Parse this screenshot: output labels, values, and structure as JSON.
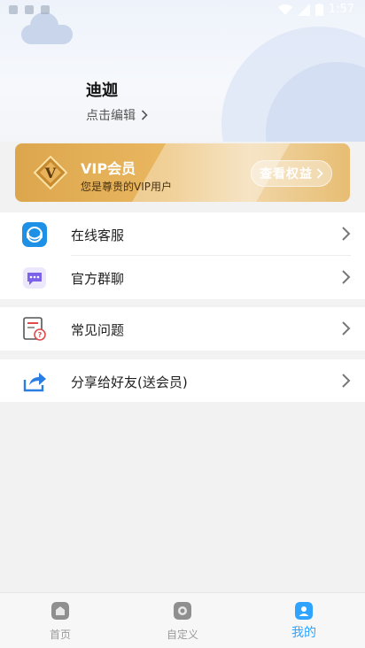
{
  "status_bar": {
    "time": "1:57"
  },
  "profile": {
    "name": "迪迦",
    "edit_label": "点击编辑"
  },
  "vip": {
    "title": "VIP会员",
    "subtitle": "您是尊贵的VIP用户",
    "button_label": "查看权益",
    "badge_letter": "V"
  },
  "menu": {
    "group1": [
      {
        "label": "在线客服",
        "icon": "customer-service-icon"
      },
      {
        "label": "官方群聊",
        "icon": "group-chat-icon"
      }
    ],
    "group2": [
      {
        "label": "常见问题",
        "icon": "faq-icon"
      }
    ],
    "group3": [
      {
        "label": "分享给好友(送会员)",
        "icon": "share-icon"
      }
    ]
  },
  "tabs": [
    {
      "label": "首页",
      "icon": "home-icon",
      "active": false
    },
    {
      "label": "自定义",
      "icon": "custom-icon",
      "active": false
    },
    {
      "label": "我的",
      "icon": "profile-icon",
      "active": true
    }
  ],
  "colors": {
    "accent": "#2ea3ff",
    "vip_gold": "#dca64d"
  }
}
